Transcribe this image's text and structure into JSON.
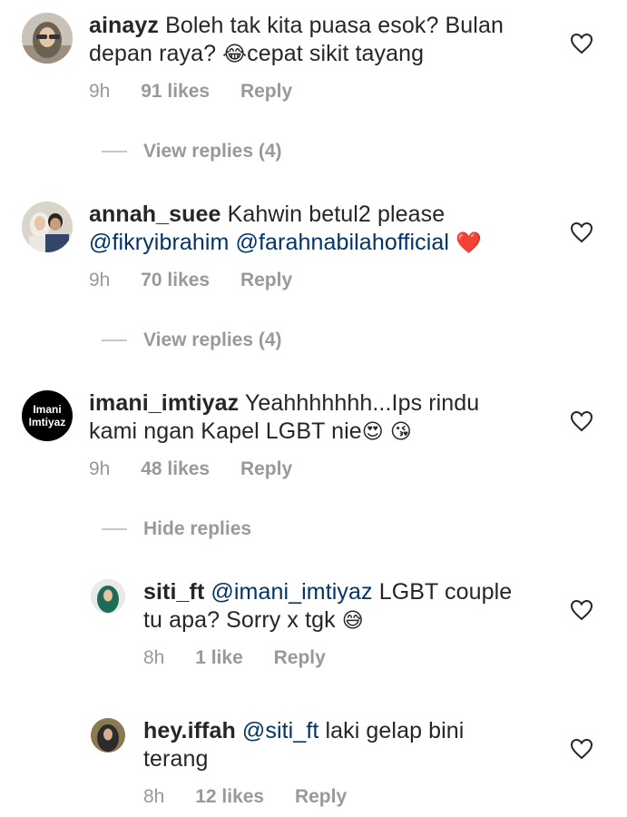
{
  "comments": [
    {
      "username": "ainayz",
      "text_line1": "Boleh tak kita puasa esok? Bulan",
      "text_line2_a": "depan raya?",
      "text_line2_emoji": "😂",
      "text_line2_b": "cepat sikit tayang",
      "time": "9h",
      "likes": "91 likes",
      "reply": "Reply",
      "avatar_icon": "user-avatar-hijab",
      "view_replies": "View replies (4)"
    },
    {
      "username": "annah_suee",
      "text_line1": "Kahwin betul2 please",
      "mention1": "@fikryibrahim",
      "mention2": "@farahnabilahofficial",
      "emoji": "❤️",
      "time": "9h",
      "likes": "70 likes",
      "reply": "Reply",
      "avatar_icon": "couple-avatar",
      "view_replies": "View replies (4)"
    },
    {
      "username": "imani_imtiyaz",
      "text_line1": "Yeahhhhhhh...Ips rindu",
      "text_line2": "kami ngan Kapel LGBT nie",
      "emoji_a": "😍",
      "emoji_b": "😘",
      "avatar_line1": "Imani",
      "avatar_line2": "Imtiyaz",
      "time": "9h",
      "likes": "48 likes",
      "reply": "Reply",
      "hide_replies": "Hide replies"
    }
  ],
  "replies": [
    {
      "username": "siti_ft",
      "mention": "@imani_imtiyaz",
      "text_line1": "LGBT couple",
      "text_line2": "tu apa? Sorry x tgk",
      "emoji": "😅",
      "time": "8h",
      "likes": "1 like",
      "reply": "Reply",
      "avatar_icon": "user-avatar-hijab-green"
    },
    {
      "username": "hey.iffah",
      "mention": "@siti_ft",
      "text_line1": "laki gelap bini",
      "text_line2": "terang",
      "time": "8h",
      "likes": "12 likes",
      "reply": "Reply",
      "avatar_icon": "user-avatar-hijab-dark"
    }
  ],
  "colors": {
    "text": "#262626",
    "mention": "#003569",
    "meta": "#999999"
  }
}
